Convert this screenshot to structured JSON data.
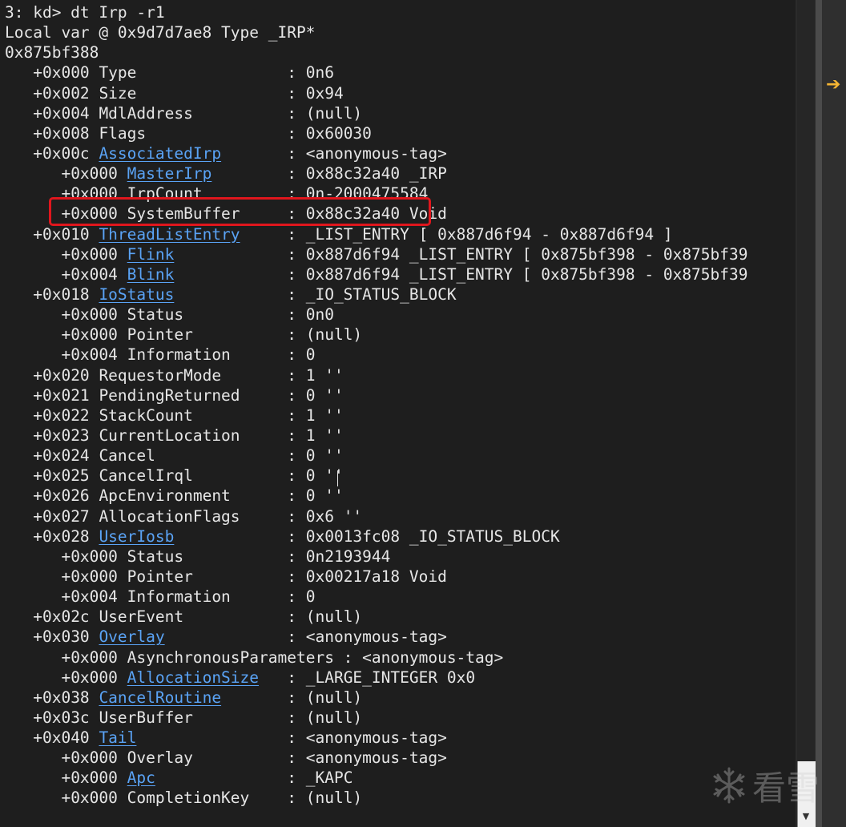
{
  "console": {
    "lines": [
      {
        "indent": "",
        "offset": "",
        "field": "3: kd> dt Irp -r1",
        "link": false,
        "field_pad": "",
        "value": ""
      },
      {
        "indent": "",
        "offset": "",
        "field": "Local var @ 0x9d7d7ae8 Type _IRP*",
        "link": false,
        "field_pad": "",
        "value": ""
      },
      {
        "indent": "",
        "offset": "",
        "field": "0x875bf388",
        "link": false,
        "field_pad": "",
        "value": ""
      },
      {
        "indent": "   ",
        "offset": "+0x000",
        "field": "Type",
        "link": false,
        "field_pad": "               ",
        "value": " : 0n6"
      },
      {
        "indent": "   ",
        "offset": "+0x002",
        "field": "Size",
        "link": false,
        "field_pad": "               ",
        "value": " : 0x94"
      },
      {
        "indent": "   ",
        "offset": "+0x004",
        "field": "MdlAddress",
        "link": false,
        "field_pad": "         ",
        "value": " : (null)"
      },
      {
        "indent": "   ",
        "offset": "+0x008",
        "field": "Flags",
        "link": false,
        "field_pad": "              ",
        "value": " : 0x60030"
      },
      {
        "indent": "   ",
        "offset": "+0x00c",
        "field": "AssociatedIrp",
        "link": true,
        "field_pad": "      ",
        "value": " : <anonymous-tag>"
      },
      {
        "indent": "      ",
        "offset": "+0x000",
        "field": "MasterIrp",
        "link": true,
        "field_pad": "       ",
        "value": " : 0x88c32a40 _IRP"
      },
      {
        "indent": "      ",
        "offset": "+0x000",
        "field": "IrpCount",
        "link": false,
        "field_pad": "        ",
        "value": " : 0n-2000475584"
      },
      {
        "indent": "      ",
        "offset": "+0x000",
        "field": "SystemBuffer",
        "link": false,
        "field_pad": "    ",
        "value": " : 0x88c32a40 Void"
      },
      {
        "indent": "   ",
        "offset": "+0x010",
        "field": "ThreadListEntry",
        "link": true,
        "field_pad": "    ",
        "value": " : _LIST_ENTRY [ 0x887d6f94 - 0x887d6f94 ]"
      },
      {
        "indent": "      ",
        "offset": "+0x000",
        "field": "Flink",
        "link": true,
        "field_pad": "           ",
        "value": " : 0x887d6f94 _LIST_ENTRY [ 0x875bf398 - 0x875bf39"
      },
      {
        "indent": "      ",
        "offset": "+0x004",
        "field": "Blink",
        "link": true,
        "field_pad": "           ",
        "value": " : 0x887d6f94 _LIST_ENTRY [ 0x875bf398 - 0x875bf39"
      },
      {
        "indent": "   ",
        "offset": "+0x018",
        "field": "IoStatus",
        "link": true,
        "field_pad": "           ",
        "value": " : _IO_STATUS_BLOCK"
      },
      {
        "indent": "      ",
        "offset": "+0x000",
        "field": "Status",
        "link": false,
        "field_pad": "          ",
        "value": " : 0n0"
      },
      {
        "indent": "      ",
        "offset": "+0x000",
        "field": "Pointer",
        "link": false,
        "field_pad": "         ",
        "value": " : (null)"
      },
      {
        "indent": "      ",
        "offset": "+0x004",
        "field": "Information",
        "link": false,
        "field_pad": "     ",
        "value": " : 0"
      },
      {
        "indent": "   ",
        "offset": "+0x020",
        "field": "RequestorMode",
        "link": false,
        "field_pad": "      ",
        "value": " : 1 ''"
      },
      {
        "indent": "   ",
        "offset": "+0x021",
        "field": "PendingReturned",
        "link": false,
        "field_pad": "    ",
        "value": " : 0 ''"
      },
      {
        "indent": "   ",
        "offset": "+0x022",
        "field": "StackCount",
        "link": false,
        "field_pad": "         ",
        "value": " : 1 ''"
      },
      {
        "indent": "   ",
        "offset": "+0x023",
        "field": "CurrentLocation",
        "link": false,
        "field_pad": "    ",
        "value": " : 1 ''"
      },
      {
        "indent": "   ",
        "offset": "+0x024",
        "field": "Cancel",
        "link": false,
        "field_pad": "             ",
        "value": " : 0 ''"
      },
      {
        "indent": "   ",
        "offset": "+0x025",
        "field": "CancelIrql",
        "link": false,
        "field_pad": "         ",
        "value": " : 0 ''"
      },
      {
        "indent": "   ",
        "offset": "+0x026",
        "field": "ApcEnvironment",
        "link": false,
        "field_pad": "     ",
        "value": " : 0 ''"
      },
      {
        "indent": "   ",
        "offset": "+0x027",
        "field": "AllocationFlags",
        "link": false,
        "field_pad": "    ",
        "value": " : 0x6 ''"
      },
      {
        "indent": "   ",
        "offset": "+0x028",
        "field": "UserIosb",
        "link": true,
        "field_pad": "           ",
        "value": " : 0x0013fc08 _IO_STATUS_BLOCK"
      },
      {
        "indent": "      ",
        "offset": "+0x000",
        "field": "Status",
        "link": false,
        "field_pad": "          ",
        "value": " : 0n2193944"
      },
      {
        "indent": "      ",
        "offset": "+0x000",
        "field": "Pointer",
        "link": false,
        "field_pad": "         ",
        "value": " : 0x00217a18 Void"
      },
      {
        "indent": "      ",
        "offset": "+0x004",
        "field": "Information",
        "link": false,
        "field_pad": "     ",
        "value": " : 0"
      },
      {
        "indent": "   ",
        "offset": "+0x02c",
        "field": "UserEvent",
        "link": false,
        "field_pad": "          ",
        "value": " : (null)"
      },
      {
        "indent": "   ",
        "offset": "+0x030",
        "field": "Overlay",
        "link": true,
        "field_pad": "            ",
        "value": " : <anonymous-tag>"
      },
      {
        "indent": "      ",
        "offset": "+0x000",
        "field": "AsynchronousParameters",
        "link": false,
        "field_pad": "",
        "value": " : <anonymous-tag>"
      },
      {
        "indent": "      ",
        "offset": "+0x000",
        "field": "AllocationSize",
        "link": true,
        "field_pad": "  ",
        "value": " : _LARGE_INTEGER 0x0"
      },
      {
        "indent": "   ",
        "offset": "+0x038",
        "field": "CancelRoutine",
        "link": true,
        "field_pad": "      ",
        "value": " : (null)"
      },
      {
        "indent": "   ",
        "offset": "+0x03c",
        "field": "UserBuffer",
        "link": false,
        "field_pad": "         ",
        "value": " : (null)"
      },
      {
        "indent": "   ",
        "offset": "+0x040",
        "field": "Tail",
        "link": true,
        "field_pad": "               ",
        "value": " : <anonymous-tag>"
      },
      {
        "indent": "      ",
        "offset": "+0x000",
        "field": "Overlay",
        "link": false,
        "field_pad": "         ",
        "value": " : <anonymous-tag>"
      },
      {
        "indent": "      ",
        "offset": "+0x000",
        "field": "Apc",
        "link": true,
        "field_pad": "             ",
        "value": " : _KAPC"
      },
      {
        "indent": "      ",
        "offset": "+0x000",
        "field": "CompletionKey",
        "link": false,
        "field_pad": "   ",
        "value": " : (null)"
      }
    ]
  },
  "side_panel": {
    "arrow_icon": "arrow-right-icon"
  },
  "watermark": {
    "text": "看雪",
    "icon": "snowflake-icon"
  },
  "colors": {
    "background": "#1e1e1e",
    "text": "#e6e6e6",
    "link": "#5aa3f5",
    "highlight_box": "#e0161d",
    "arrow": "#f5b533"
  }
}
